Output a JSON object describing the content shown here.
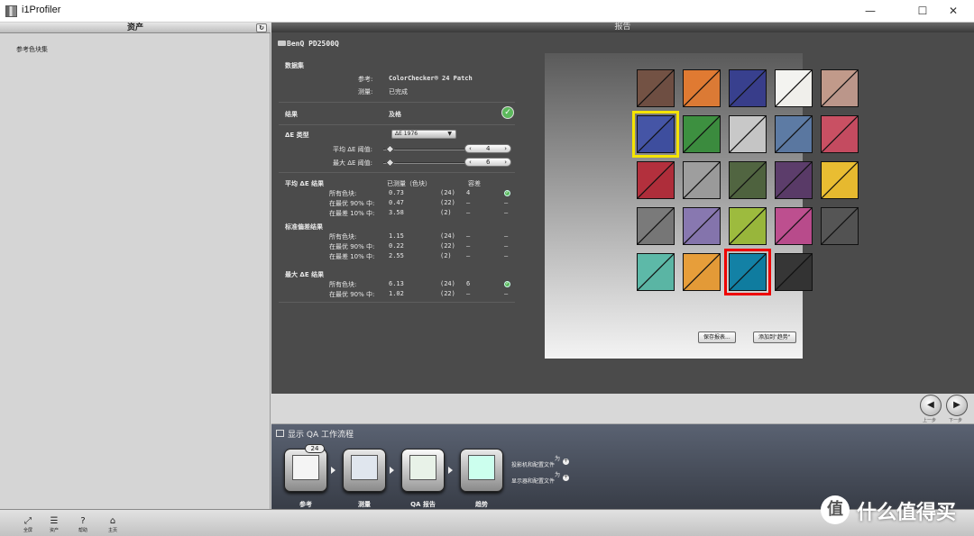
{
  "window": {
    "title": "i1Profiler",
    "minimize": "—",
    "maximize": "☐",
    "close": "✕"
  },
  "left_panel": {
    "header": "资产",
    "refresh": "↻",
    "item": "参考色块集"
  },
  "report": {
    "header": "报告",
    "device": "BenQ PD2500Q",
    "dataset_label": "数据集",
    "ref_label": "参考:",
    "ref_value": "ColorChecker® 24 Patch",
    "measure_label": "测量:",
    "measure_value": "已完成",
    "result_label": "结果",
    "result_value": "及格",
    "de_type_label": "ΔE 类型",
    "de_type_value": "ΔE 1976",
    "avg_threshold_label": "平均 ΔE 阈值:",
    "avg_threshold_value": "4",
    "max_threshold_label": "最大 ΔE 阈值:",
    "max_threshold_value": "6",
    "avg_section": {
      "title": "平均 ΔE 结果",
      "col_measured": "已测量（色块）",
      "col_tolerance": "容差",
      "rows": [
        {
          "label": "所有色块:",
          "value": "0.73",
          "count": "(24)",
          "tol": "4",
          "status": "ok"
        },
        {
          "label": "在最优 90% 中:",
          "value": "0.47",
          "count": "(22)",
          "tol": "–",
          "status": "–"
        },
        {
          "label": "在最差 10% 中:",
          "value": "3.58",
          "count": "(2)",
          "tol": "–",
          "status": "–"
        }
      ]
    },
    "std_section": {
      "title": "标准偏差结果",
      "rows": [
        {
          "label": "所有色块:",
          "value": "1.15",
          "count": "(24)",
          "tol": "–",
          "status": "–"
        },
        {
          "label": "在最优 90% 中:",
          "value": "0.22",
          "count": "(22)",
          "tol": "–",
          "status": "–"
        },
        {
          "label": "在最差 10% 中:",
          "value": "2.55",
          "count": "(2)",
          "tol": "–",
          "status": "–"
        }
      ]
    },
    "max_section": {
      "title": "最大 ΔE 结果",
      "rows": [
        {
          "label": "所有色块:",
          "value": "6.13",
          "count": "(24)",
          "tol": "6",
          "status": "ok"
        },
        {
          "label": "在最优 90% 中:",
          "value": "1.02",
          "count": "(22)",
          "tol": "–",
          "status": "–"
        }
      ]
    },
    "save_report": "保存报表...",
    "add_trend": "添加到\"趋势\"",
    "patches": [
      {
        "ref": "#735244",
        "meas": "#6e4e42"
      },
      {
        "ref": "#e07a32",
        "meas": "#db7a35"
      },
      {
        "ref": "#38408e",
        "meas": "#383d8a"
      },
      {
        "ref": "#f3f3f0",
        "meas": "#f0efeb"
      },
      {
        "ref": "#c19a8a",
        "meas": "#bb968a"
      },
      {
        "ref": "#ffffff",
        "meas": "#ffffff"
      },
      {
        "ref": "#4555a6",
        "meas": "#3e4e9e",
        "highlight": "yellow"
      },
      {
        "ref": "#3d9040",
        "meas": "#3b8b3e"
      },
      {
        "ref": "#c8c8c8",
        "meas": "#c5c5c5"
      },
      {
        "ref": "#5d7ba4",
        "meas": "#5a77a0"
      },
      {
        "ref": "#c95063",
        "meas": "#c44b60"
      },
      {
        "ref": "#ffffff",
        "meas": "#ffffff"
      },
      {
        "ref": "#b3303d",
        "meas": "#ae2d3a"
      },
      {
        "ref": "#9e9e9e",
        "meas": "#9a9a9a"
      },
      {
        "ref": "#516541",
        "meas": "#4e623e"
      },
      {
        "ref": "#5c3d6b",
        "meas": "#593a67"
      },
      {
        "ref": "#e9bd32",
        "meas": "#e6b92f"
      },
      {
        "ref": "#ffffff",
        "meas": "#ffffff"
      },
      {
        "ref": "#7a7a7a",
        "meas": "#767676"
      },
      {
        "ref": "#8878b0",
        "meas": "#8474ac"
      },
      {
        "ref": "#9dbb3e",
        "meas": "#98b63b"
      },
      {
        "ref": "#bd4f8f",
        "meas": "#b84b8b"
      },
      {
        "ref": "#555555",
        "meas": "#525252"
      },
      {
        "ref": "#ffffff",
        "meas": "#ffffff"
      },
      {
        "ref": "#5db9a8",
        "meas": "#5ab5a4"
      },
      {
        "ref": "#e79e3a",
        "meas": "#e39a37"
      },
      {
        "ref": "#1381a5",
        "meas": "#0f7c9f",
        "highlight": "red"
      },
      {
        "ref": "#363636",
        "meas": "#333333"
      }
    ]
  },
  "nav": {
    "prev": "◀",
    "next": "▶",
    "prev_label": "上一步",
    "next_label": "下一步"
  },
  "workflow": {
    "title": "显示 QA 工作流程",
    "badge": "24",
    "steps": [
      "参考",
      "测量",
      "QA 报告",
      "趋势"
    ],
    "option1": "投影机和配置文件",
    "option2": "显示器和配置文件",
    "option_suffix": "为"
  },
  "bottom_bar": {
    "items": [
      "全屏",
      "资产",
      "帮助",
      "主页"
    ]
  },
  "watermark": {
    "logo": "值",
    "text": "什么值得买"
  }
}
